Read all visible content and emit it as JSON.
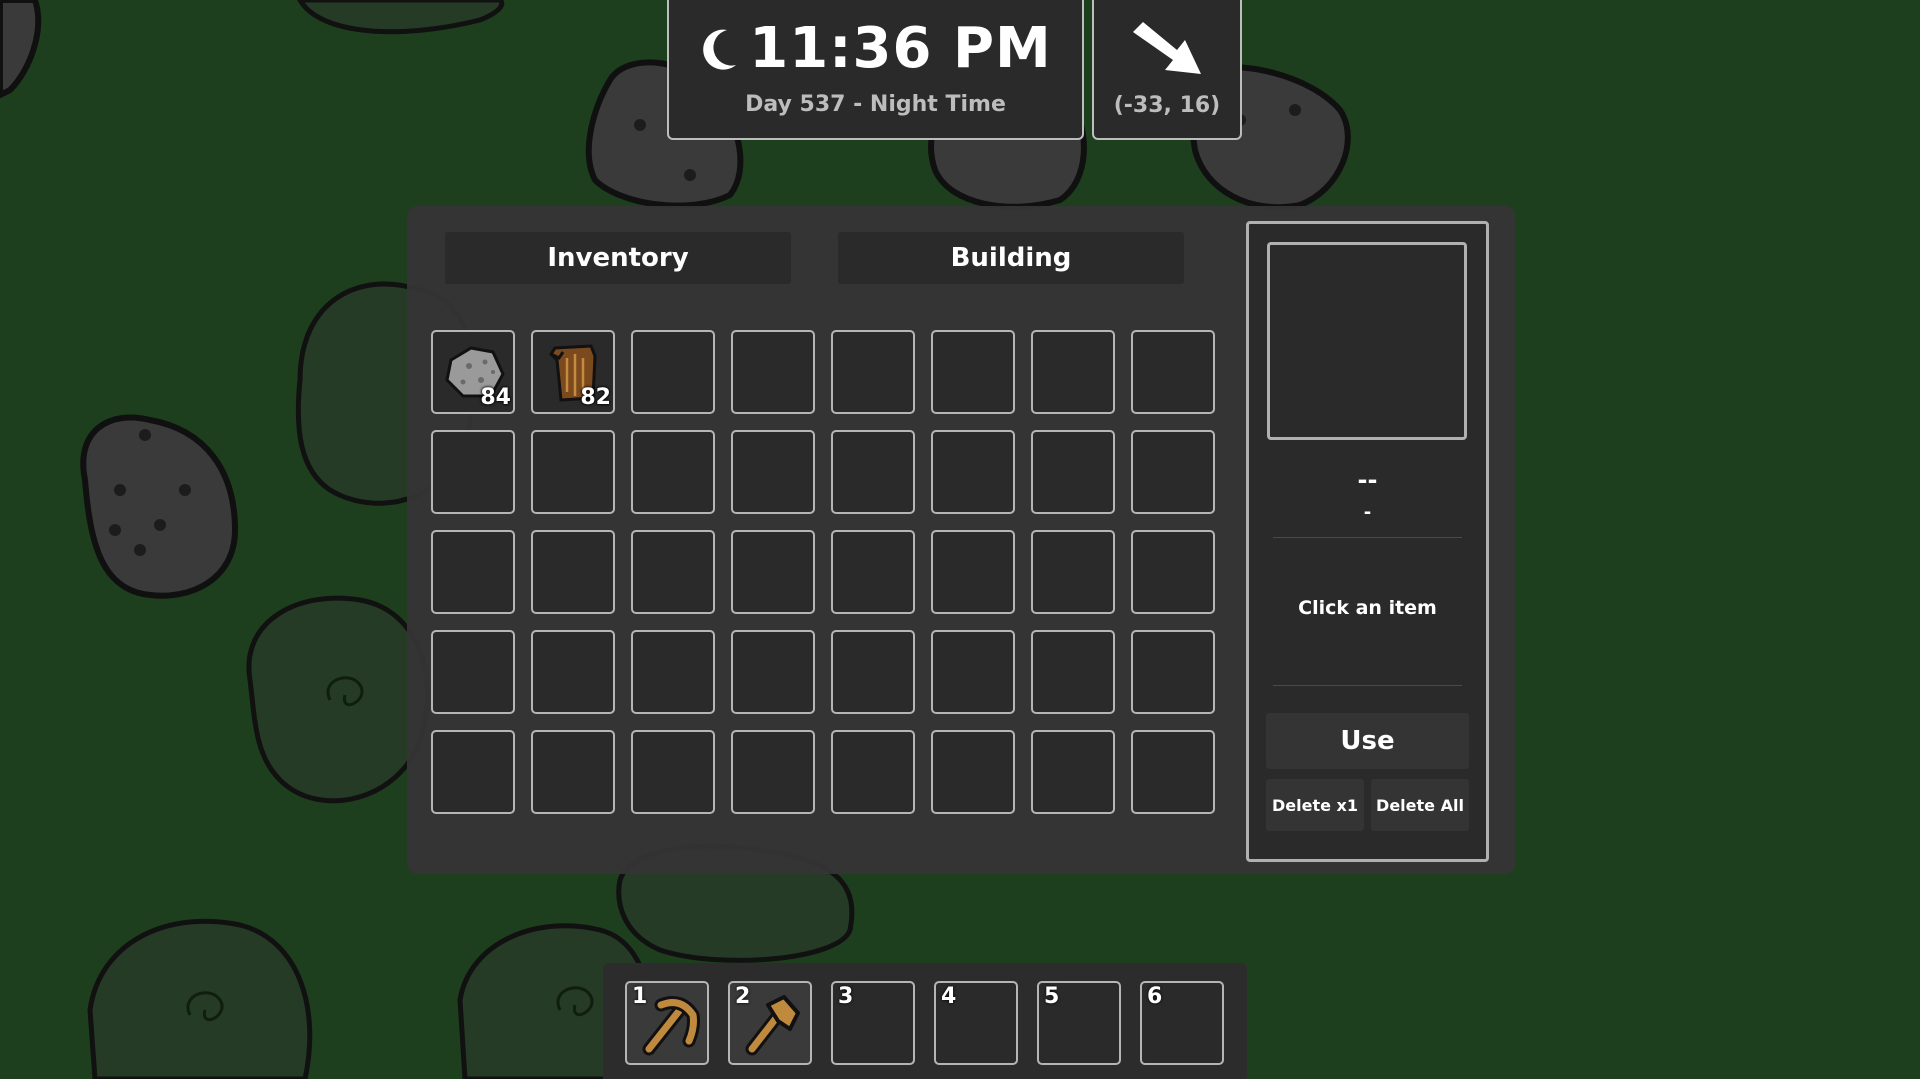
{
  "clock": {
    "time": "11:36 PM",
    "subtitle": "Day 537 - Night Time",
    "icon": "moon-icon"
  },
  "compass": {
    "icon": "arrow-down-right-icon",
    "coords": "(-33, 16)"
  },
  "tabs": {
    "inventory": "Inventory",
    "building": "Building"
  },
  "inventory": {
    "columns": 8,
    "rows": 5,
    "items": [
      {
        "slot": 0,
        "name": "stone",
        "icon": "stone-icon",
        "qty": "84"
      },
      {
        "slot": 1,
        "name": "wood",
        "icon": "wood-icon",
        "qty": "82"
      }
    ]
  },
  "details": {
    "name": "--",
    "type": "-",
    "description": "Click an item",
    "use_label": "Use",
    "delete_one_label": "Delete x1",
    "delete_all_label": "Delete All"
  },
  "hotbar": {
    "slots": [
      {
        "number": "1",
        "tool": "pickaxe-icon"
      },
      {
        "number": "2",
        "tool": "axe-icon"
      },
      {
        "number": "3",
        "tool": ""
      },
      {
        "number": "4",
        "tool": ""
      },
      {
        "number": "5",
        "tool": ""
      },
      {
        "number": "6",
        "tool": ""
      }
    ]
  },
  "colors": {
    "ground": "#1e3f1e",
    "bush": "#263b26",
    "rock": "#3a3a3a",
    "panel": "#343434",
    "slot": "#2a2a2a",
    "slot_border": "#b5b5b5",
    "tool": "#c08a3e"
  }
}
